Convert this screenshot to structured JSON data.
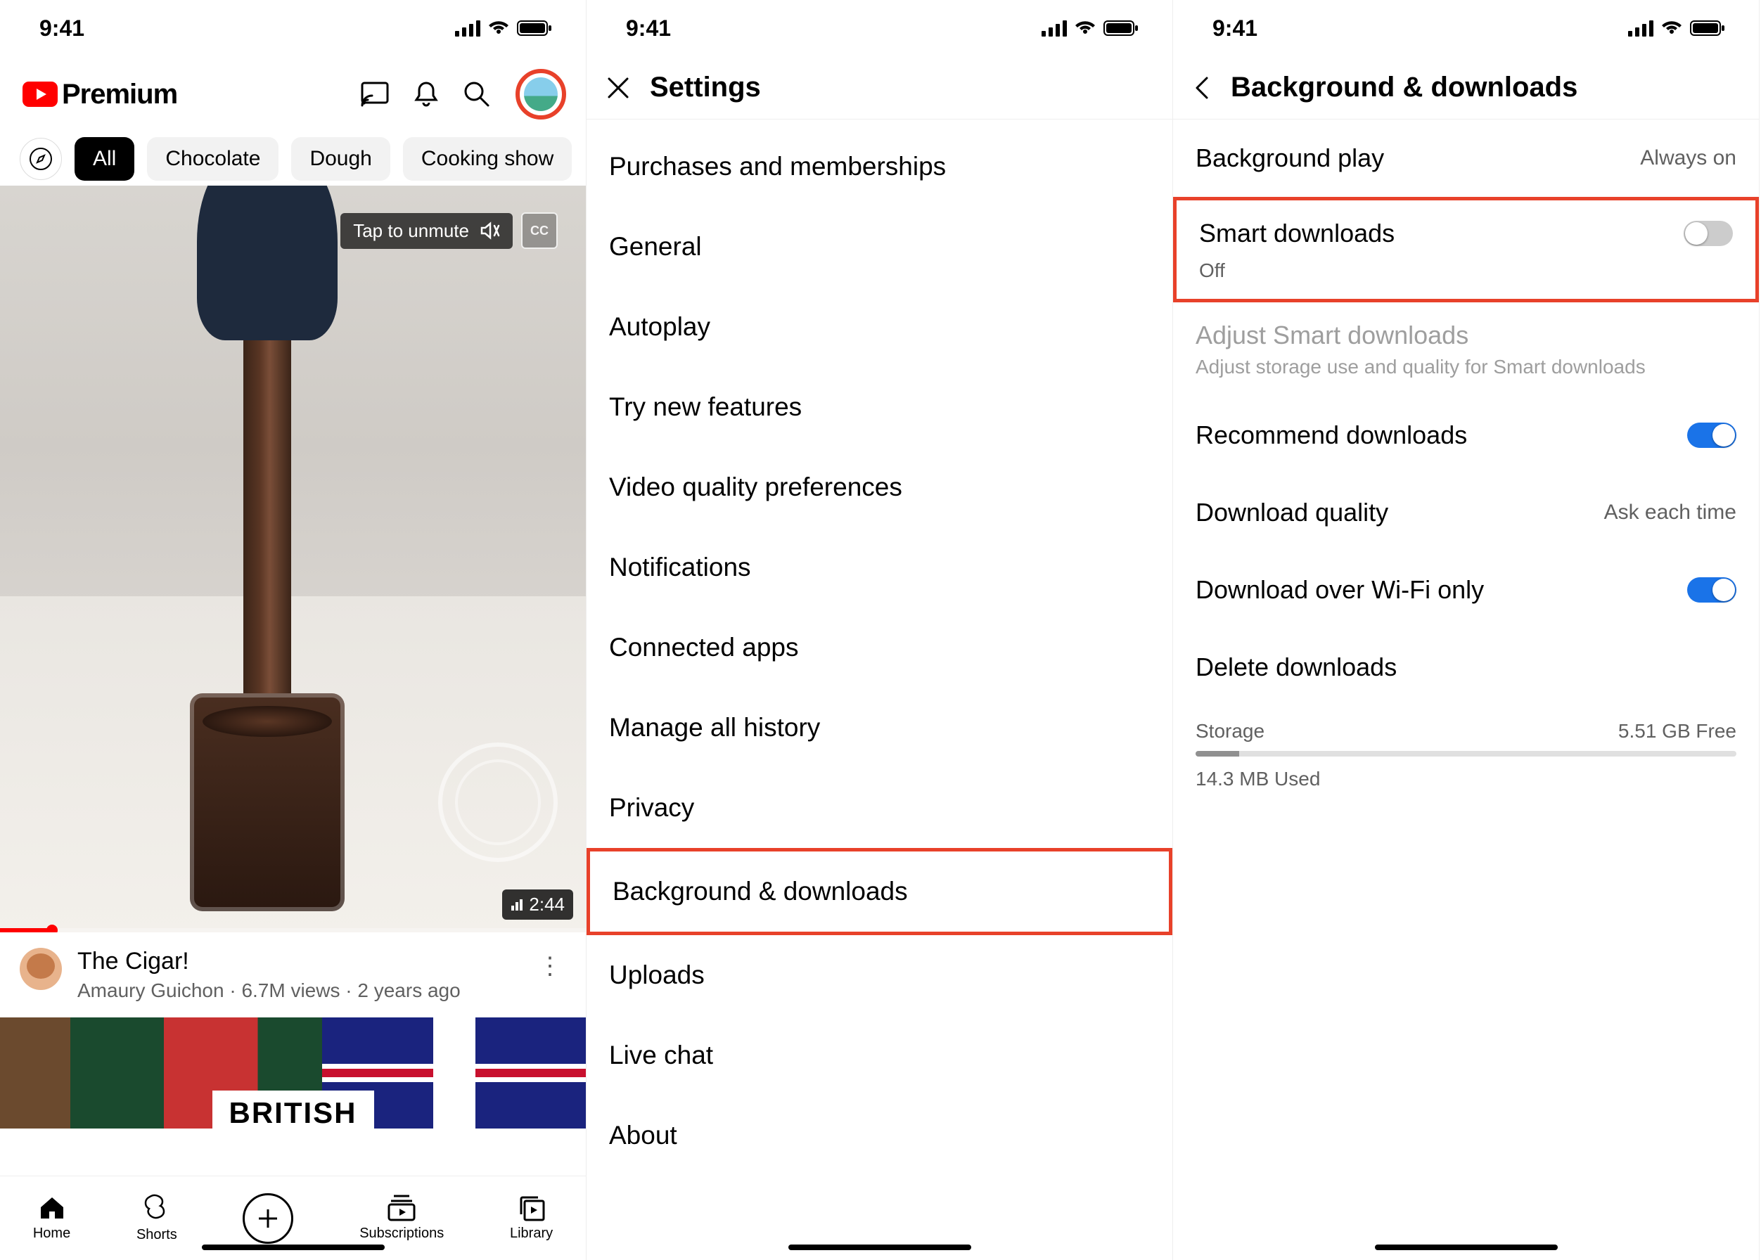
{
  "status": {
    "time": "9:41"
  },
  "screen1": {
    "logo_text": "Premium",
    "chips": [
      "All",
      "Chocolate",
      "Dough",
      "Cooking show"
    ],
    "unmute": "Tap to unmute",
    "cc": "CC",
    "duration": "2:44",
    "video": {
      "title": "The Cigar!",
      "channel": "Amaury Guichon",
      "views": "6.7M views",
      "age": "2 years ago"
    },
    "second_label": "BRITISH",
    "nav": {
      "home": "Home",
      "shorts": "Shorts",
      "subs": "Subscriptions",
      "library": "Library"
    }
  },
  "screen2": {
    "title": "Settings",
    "items": [
      "Purchases and memberships",
      "General",
      "Autoplay",
      "Try new features",
      "Video quality preferences",
      "Notifications",
      "Connected apps",
      "Manage all history",
      "Privacy",
      "Background & downloads",
      "Uploads",
      "Live chat",
      "About"
    ]
  },
  "screen3": {
    "title": "Background & downloads",
    "bg_play": {
      "label": "Background play",
      "value": "Always on"
    },
    "smart": {
      "label": "Smart downloads",
      "sub": "Off"
    },
    "adjust": {
      "label": "Adjust Smart downloads",
      "sub": "Adjust storage use and quality for Smart downloads"
    },
    "recommend": "Recommend downloads",
    "quality": {
      "label": "Download quality",
      "value": "Ask each time"
    },
    "wifi": "Download over Wi-Fi only",
    "delete": "Delete downloads",
    "storage": {
      "label": "Storage",
      "free": "5.51 GB Free",
      "used": "14.3 MB Used"
    }
  }
}
